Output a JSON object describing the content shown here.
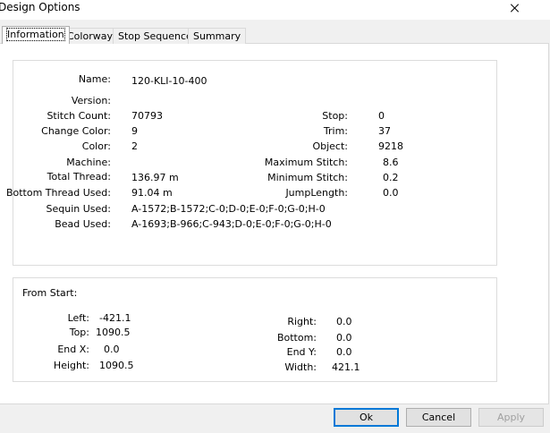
{
  "window": {
    "title": "Design Options"
  },
  "tabs": [
    {
      "label": "Information"
    },
    {
      "label": "Colorway"
    },
    {
      "label": "Stop Sequence"
    },
    {
      "label": "Summary"
    }
  ],
  "info": {
    "name": {
      "label": "Name:",
      "value": "120-KLI-10-400"
    },
    "version": {
      "label": "Version:",
      "value": ""
    },
    "stitch_count": {
      "label": "Stitch Count:",
      "value": "70793"
    },
    "change_color": {
      "label": "Change Color:",
      "value": "9"
    },
    "color": {
      "label": "Color:",
      "value": "2"
    },
    "machine": {
      "label": "Machine:",
      "value": ""
    },
    "total_thread": {
      "label": "Total Thread:",
      "value": "136.97 m"
    },
    "bottom_thread": {
      "label": "Bottom Thread Used:",
      "value": "91.04 m"
    },
    "sequin_used": {
      "label": "Sequin Used:",
      "value": "A-1572;B-1572;C-0;D-0;E-0;F-0;G-0;H-0"
    },
    "bead_used": {
      "label": "Bead Used:",
      "value": "A-1693;B-966;C-943;D-0;E-0;F-0;G-0;H-0"
    },
    "stop": {
      "label": "Stop:",
      "value": "0"
    },
    "trim": {
      "label": "Trim:",
      "value": "37"
    },
    "object": {
      "label": "Object:",
      "value": "9218"
    },
    "max_stitch": {
      "label": "Maximum Stitch:",
      "value": "8.6"
    },
    "min_stitch": {
      "label": "Minimum Stitch:",
      "value": "0.2"
    },
    "jump_length": {
      "label": "JumpLength:",
      "value": "0.0"
    }
  },
  "from_start": {
    "title": "From Start:",
    "left": {
      "label": "Left:",
      "value": "-421.1"
    },
    "top": {
      "label": "Top:",
      "value": "1090.5"
    },
    "end_x": {
      "label": "End X:",
      "value": "0.0"
    },
    "height": {
      "label": "Height:",
      "value": "1090.5"
    },
    "right": {
      "label": "Right:",
      "value": "0.0"
    },
    "bottom": {
      "label": "Bottom:",
      "value": "0.0"
    },
    "end_y": {
      "label": "End Y:",
      "value": "0.0"
    },
    "width": {
      "label": "Width:",
      "value": "421.1"
    }
  },
  "buttons": {
    "ok": "Ok",
    "cancel": "Cancel",
    "apply": "Apply"
  }
}
